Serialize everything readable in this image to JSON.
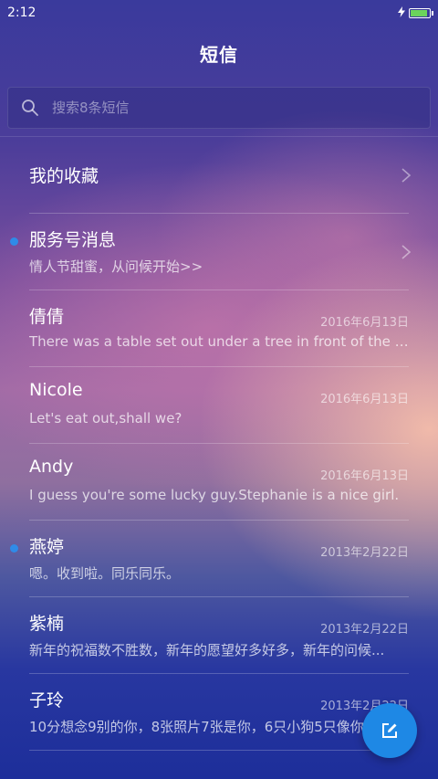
{
  "status_bar": {
    "time": "2:12",
    "battery_color": "#6bd35b",
    "battery_level": 0.95
  },
  "header": {
    "title": "短信"
  },
  "search": {
    "placeholder": "搜索8条短信"
  },
  "favorites": {
    "label": "我的收藏"
  },
  "conversations": [
    {
      "name": "服务号消息",
      "preview": "情人节甜蜜，从问候开始>>",
      "date": "",
      "unread": true,
      "chevron": true
    },
    {
      "name": "倩倩",
      "preview": "There was a table set out under a tree in front of the ho...",
      "date": "2016年6月13日",
      "unread": false
    },
    {
      "name": "Nicole",
      "preview": "Let's eat out,shall we?",
      "date": "2016年6月13日",
      "unread": false
    },
    {
      "name": "Andy",
      "preview": "I guess you're some lucky guy.Stephanie is a nice girl.",
      "date": "2016年6月13日",
      "unread": false
    },
    {
      "name": "燕婷",
      "preview": "嗯。收到啦。同乐同乐。",
      "date": "2013年2月22日",
      "unread": true
    },
    {
      "name": "紫楠",
      "preview": "新年的祝福数不胜数，新年的愿望好多好多，新年的问候...",
      "date": "2013年2月22日",
      "unread": false
    },
    {
      "name": "子玲",
      "preview": "10分想念9别的你，8张照片7张是你，6只小狗5只像你",
      "date": "2013年2月22日",
      "unread": false
    }
  ],
  "icons": {
    "search": "search-icon",
    "chevron": "chevron-right-icon",
    "compose": "compose-icon",
    "charging": "bolt-icon",
    "battery": "battery-icon"
  },
  "colors": {
    "accent": "#1e88e5",
    "unread_dot": "#2f8be8"
  }
}
